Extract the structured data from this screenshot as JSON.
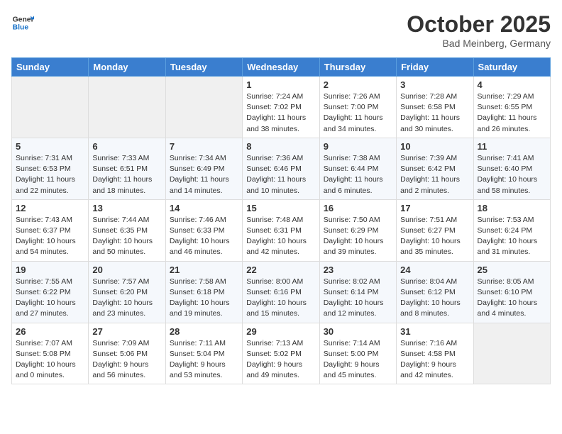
{
  "header": {
    "logo_line1": "General",
    "logo_line2": "Blue",
    "month": "October 2025",
    "location": "Bad Meinberg, Germany"
  },
  "weekdays": [
    "Sunday",
    "Monday",
    "Tuesday",
    "Wednesday",
    "Thursday",
    "Friday",
    "Saturday"
  ],
  "weeks": [
    [
      {
        "day": "",
        "info": ""
      },
      {
        "day": "",
        "info": ""
      },
      {
        "day": "",
        "info": ""
      },
      {
        "day": "1",
        "info": "Sunrise: 7:24 AM\nSunset: 7:02 PM\nDaylight: 11 hours\nand 38 minutes."
      },
      {
        "day": "2",
        "info": "Sunrise: 7:26 AM\nSunset: 7:00 PM\nDaylight: 11 hours\nand 34 minutes."
      },
      {
        "day": "3",
        "info": "Sunrise: 7:28 AM\nSunset: 6:58 PM\nDaylight: 11 hours\nand 30 minutes."
      },
      {
        "day": "4",
        "info": "Sunrise: 7:29 AM\nSunset: 6:55 PM\nDaylight: 11 hours\nand 26 minutes."
      }
    ],
    [
      {
        "day": "5",
        "info": "Sunrise: 7:31 AM\nSunset: 6:53 PM\nDaylight: 11 hours\nand 22 minutes."
      },
      {
        "day": "6",
        "info": "Sunrise: 7:33 AM\nSunset: 6:51 PM\nDaylight: 11 hours\nand 18 minutes."
      },
      {
        "day": "7",
        "info": "Sunrise: 7:34 AM\nSunset: 6:49 PM\nDaylight: 11 hours\nand 14 minutes."
      },
      {
        "day": "8",
        "info": "Sunrise: 7:36 AM\nSunset: 6:46 PM\nDaylight: 11 hours\nand 10 minutes."
      },
      {
        "day": "9",
        "info": "Sunrise: 7:38 AM\nSunset: 6:44 PM\nDaylight: 11 hours\nand 6 minutes."
      },
      {
        "day": "10",
        "info": "Sunrise: 7:39 AM\nSunset: 6:42 PM\nDaylight: 11 hours\nand 2 minutes."
      },
      {
        "day": "11",
        "info": "Sunrise: 7:41 AM\nSunset: 6:40 PM\nDaylight: 10 hours\nand 58 minutes."
      }
    ],
    [
      {
        "day": "12",
        "info": "Sunrise: 7:43 AM\nSunset: 6:37 PM\nDaylight: 10 hours\nand 54 minutes."
      },
      {
        "day": "13",
        "info": "Sunrise: 7:44 AM\nSunset: 6:35 PM\nDaylight: 10 hours\nand 50 minutes."
      },
      {
        "day": "14",
        "info": "Sunrise: 7:46 AM\nSunset: 6:33 PM\nDaylight: 10 hours\nand 46 minutes."
      },
      {
        "day": "15",
        "info": "Sunrise: 7:48 AM\nSunset: 6:31 PM\nDaylight: 10 hours\nand 42 minutes."
      },
      {
        "day": "16",
        "info": "Sunrise: 7:50 AM\nSunset: 6:29 PM\nDaylight: 10 hours\nand 39 minutes."
      },
      {
        "day": "17",
        "info": "Sunrise: 7:51 AM\nSunset: 6:27 PM\nDaylight: 10 hours\nand 35 minutes."
      },
      {
        "day": "18",
        "info": "Sunrise: 7:53 AM\nSunset: 6:24 PM\nDaylight: 10 hours\nand 31 minutes."
      }
    ],
    [
      {
        "day": "19",
        "info": "Sunrise: 7:55 AM\nSunset: 6:22 PM\nDaylight: 10 hours\nand 27 minutes."
      },
      {
        "day": "20",
        "info": "Sunrise: 7:57 AM\nSunset: 6:20 PM\nDaylight: 10 hours\nand 23 minutes."
      },
      {
        "day": "21",
        "info": "Sunrise: 7:58 AM\nSunset: 6:18 PM\nDaylight: 10 hours\nand 19 minutes."
      },
      {
        "day": "22",
        "info": "Sunrise: 8:00 AM\nSunset: 6:16 PM\nDaylight: 10 hours\nand 15 minutes."
      },
      {
        "day": "23",
        "info": "Sunrise: 8:02 AM\nSunset: 6:14 PM\nDaylight: 10 hours\nand 12 minutes."
      },
      {
        "day": "24",
        "info": "Sunrise: 8:04 AM\nSunset: 6:12 PM\nDaylight: 10 hours\nand 8 minutes."
      },
      {
        "day": "25",
        "info": "Sunrise: 8:05 AM\nSunset: 6:10 PM\nDaylight: 10 hours\nand 4 minutes."
      }
    ],
    [
      {
        "day": "26",
        "info": "Sunrise: 7:07 AM\nSunset: 5:08 PM\nDaylight: 10 hours\nand 0 minutes."
      },
      {
        "day": "27",
        "info": "Sunrise: 7:09 AM\nSunset: 5:06 PM\nDaylight: 9 hours\nand 56 minutes."
      },
      {
        "day": "28",
        "info": "Sunrise: 7:11 AM\nSunset: 5:04 PM\nDaylight: 9 hours\nand 53 minutes."
      },
      {
        "day": "29",
        "info": "Sunrise: 7:13 AM\nSunset: 5:02 PM\nDaylight: 9 hours\nand 49 minutes."
      },
      {
        "day": "30",
        "info": "Sunrise: 7:14 AM\nSunset: 5:00 PM\nDaylight: 9 hours\nand 45 minutes."
      },
      {
        "day": "31",
        "info": "Sunrise: 7:16 AM\nSunset: 4:58 PM\nDaylight: 9 hours\nand 42 minutes."
      },
      {
        "day": "",
        "info": ""
      }
    ]
  ]
}
